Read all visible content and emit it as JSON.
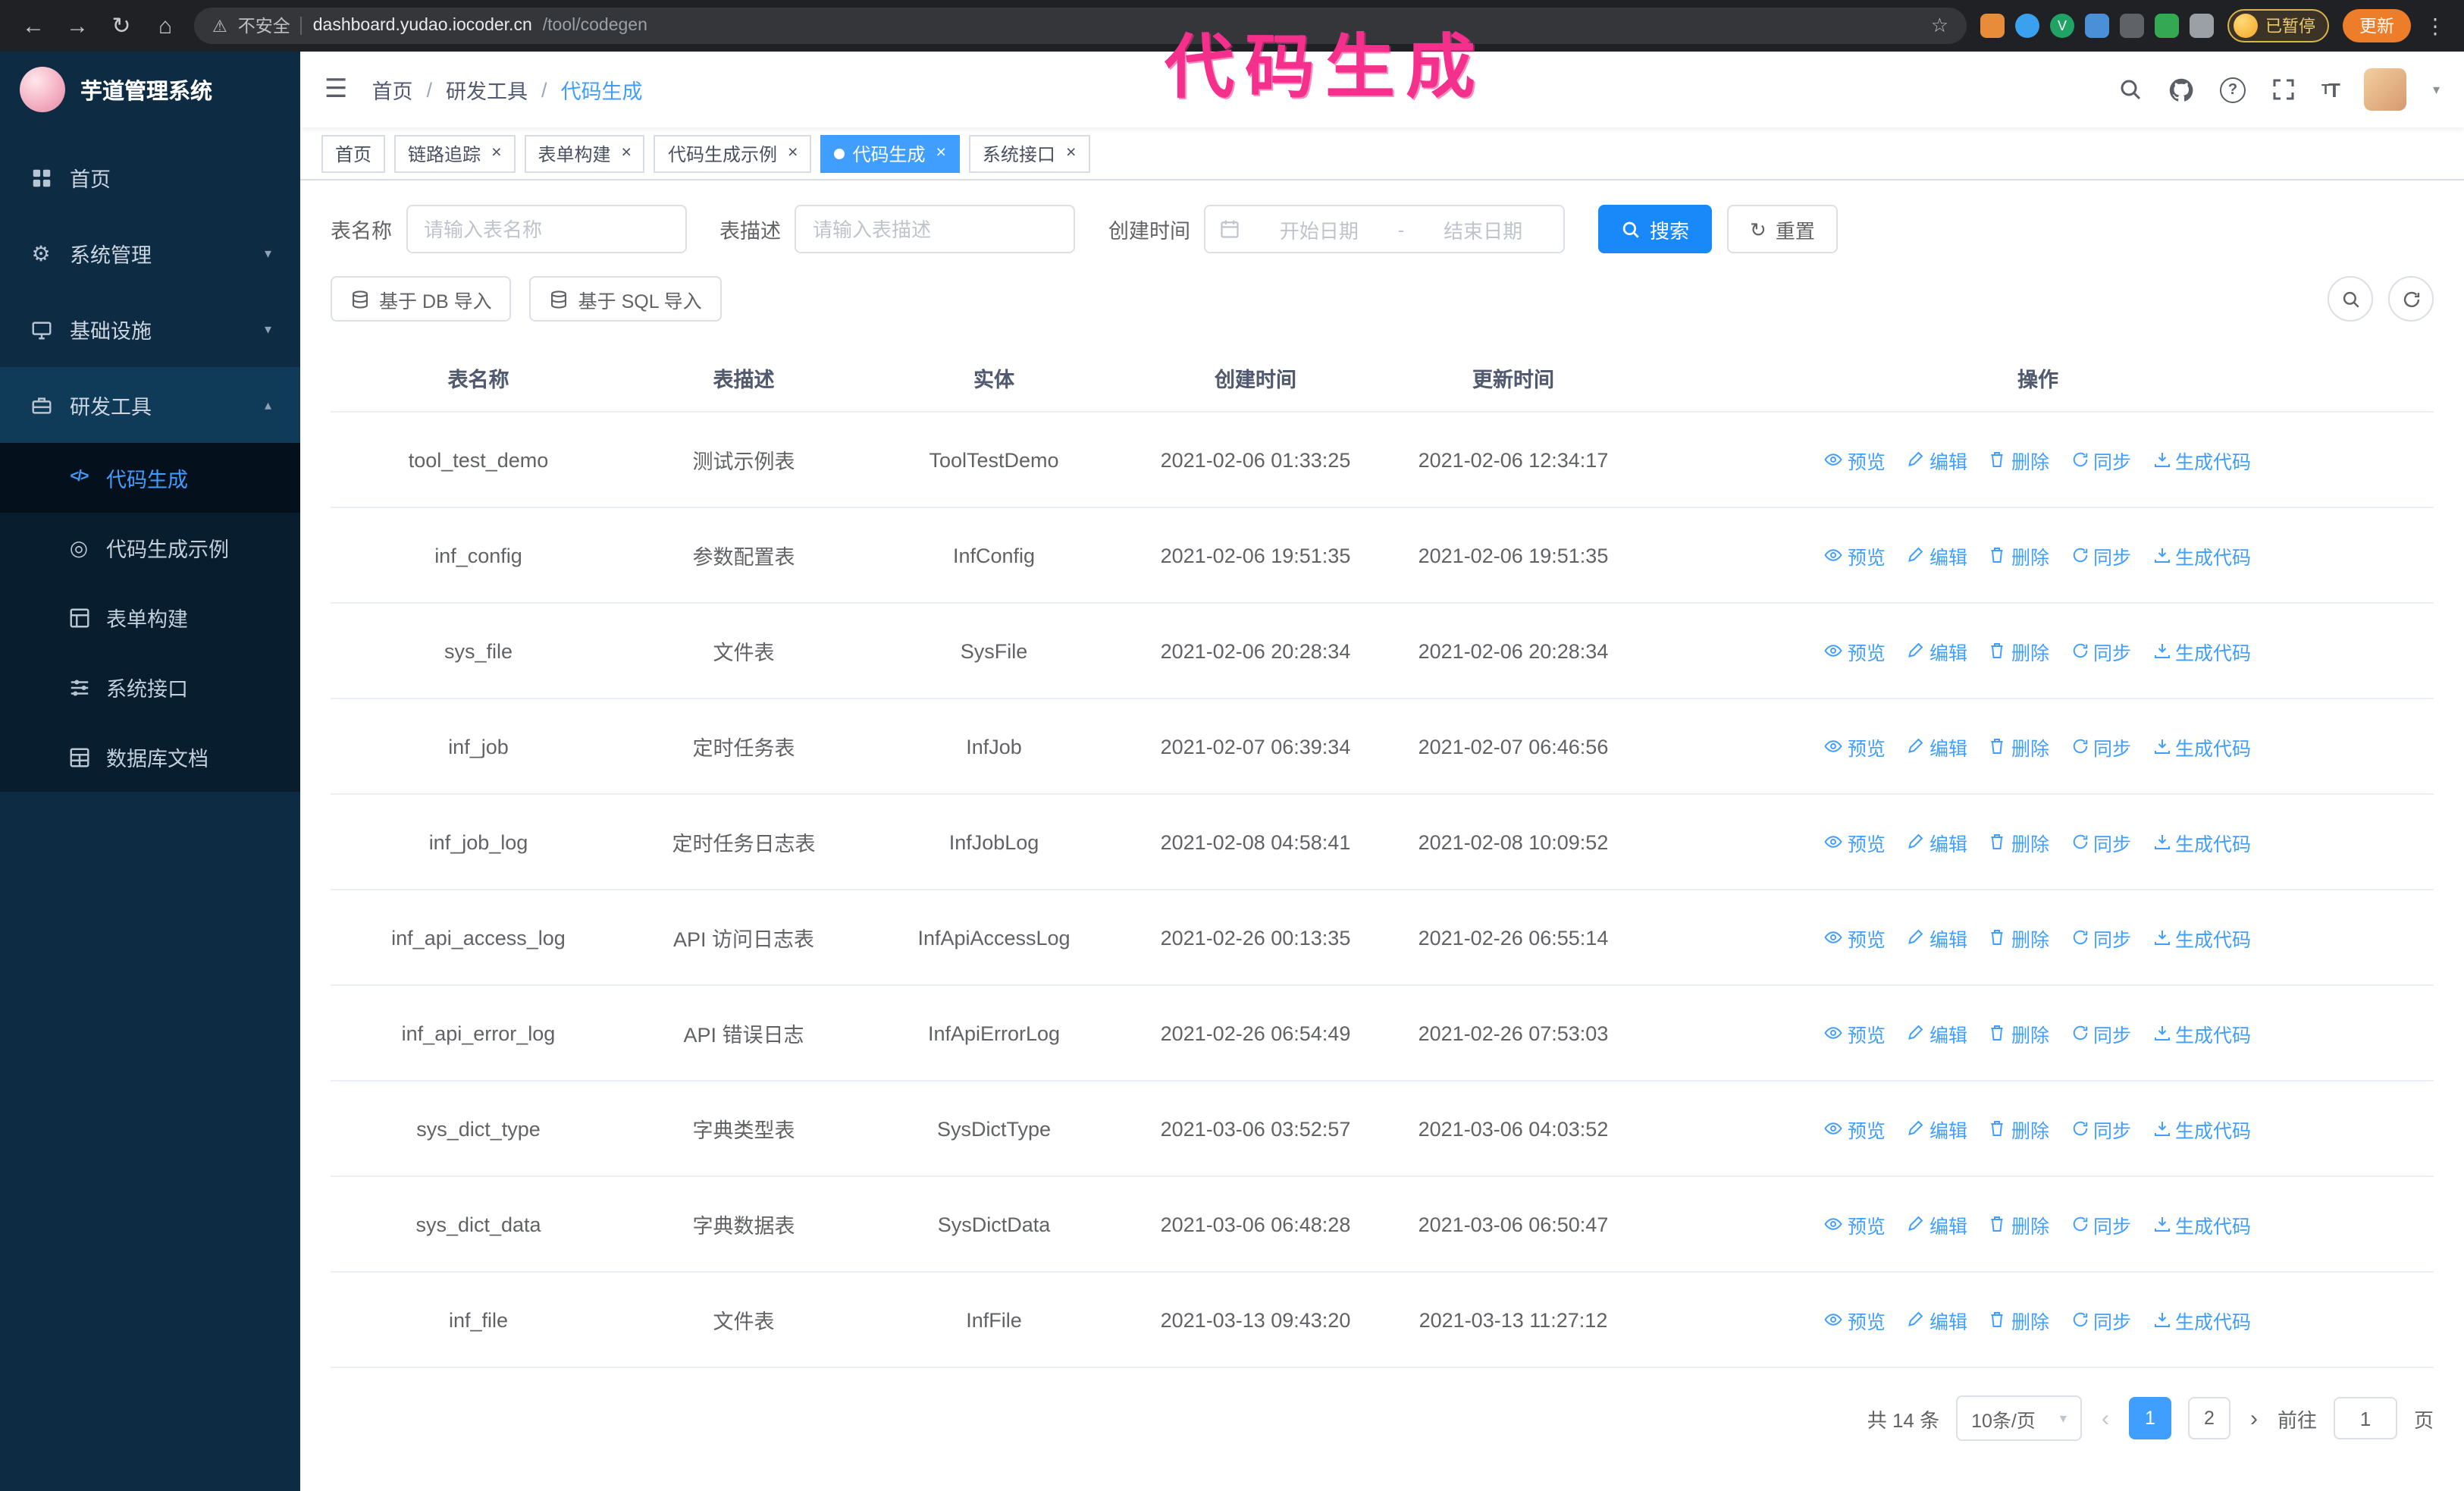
{
  "ui": {
    "close": "×",
    "slash": "/",
    "caret_down": "▾",
    "caret_up": "▴",
    "prev": "‹",
    "next": "›"
  },
  "icons": {
    "back": "←",
    "forward": "→",
    "reload": "↻",
    "home": "⌂",
    "warning": "⚠",
    "star": "☆",
    "more": "⋮",
    "gear": "⚙",
    "target": "◎",
    "hamburger": "☰",
    "code": "</>"
  },
  "browser": {
    "security": "不安全",
    "host": "dashboard.yudao.iocoder.cn",
    "path": "/tool/codegen",
    "paused": "已暂停",
    "update": "更新"
  },
  "annotation": {
    "text": "代码生成"
  },
  "sidebar": {
    "title": "芋道管理系统",
    "items": [
      {
        "label": "首页"
      },
      {
        "label": "系统管理"
      },
      {
        "label": "基础设施"
      },
      {
        "label": "研发工具"
      }
    ],
    "subitems": [
      {
        "label": "代码生成"
      },
      {
        "label": "代码生成示例"
      },
      {
        "label": "表单构建"
      },
      {
        "label": "系统接口"
      },
      {
        "label": "数据库文档"
      }
    ]
  },
  "header": {
    "breadcrumb": [
      "首页",
      "研发工具",
      "代码生成"
    ]
  },
  "tabs": [
    {
      "label": "首页"
    },
    {
      "label": "链路追踪"
    },
    {
      "label": "表单构建"
    },
    {
      "label": "代码生成示例"
    },
    {
      "label": "代码生成"
    },
    {
      "label": "系统接口"
    }
  ],
  "filters": {
    "name_label": "表名称",
    "name_placeholder": "请输入表名称",
    "desc_label": "表描述",
    "desc_placeholder": "请输入表描述",
    "time_label": "创建时间",
    "start_placeholder": "开始日期",
    "range_sep": "-",
    "end_placeholder": "结束日期",
    "search": "搜索",
    "reset": "重置"
  },
  "toolbar": {
    "import_db": "基于 DB 导入",
    "import_sql": "基于 SQL 导入"
  },
  "table": {
    "columns": [
      "表名称",
      "表描述",
      "实体",
      "创建时间",
      "更新时间",
      "操作"
    ],
    "actions": [
      "预览",
      "编辑",
      "删除",
      "同步",
      "生成代码"
    ],
    "rows": [
      {
        "name": "tool_test_demo",
        "desc": "测试示例表",
        "entity": "ToolTestDemo",
        "created": "2021-02-06 01:33:25",
        "updated": "2021-02-06 12:34:17"
      },
      {
        "name": "inf_config",
        "desc": "参数配置表",
        "entity": "InfConfig",
        "created": "2021-02-06 19:51:35",
        "updated": "2021-02-06 19:51:35"
      },
      {
        "name": "sys_file",
        "desc": "文件表",
        "entity": "SysFile",
        "created": "2021-02-06 20:28:34",
        "updated": "2021-02-06 20:28:34"
      },
      {
        "name": "inf_job",
        "desc": "定时任务表",
        "entity": "InfJob",
        "created": "2021-02-07 06:39:34",
        "updated": "2021-02-07 06:46:56"
      },
      {
        "name": "inf_job_log",
        "desc": "定时任务日志表",
        "entity": "InfJobLog",
        "created": "2021-02-08 04:58:41",
        "updated": "2021-02-08 10:09:52"
      },
      {
        "name": "inf_api_access_log",
        "desc": "API 访问日志表",
        "entity": "InfApiAccessLog",
        "created": "2021-02-26 00:13:35",
        "updated": "2021-02-26 06:55:14"
      },
      {
        "name": "inf_api_error_log",
        "desc": "API 错误日志",
        "entity": "InfApiErrorLog",
        "created": "2021-02-26 06:54:49",
        "updated": "2021-02-26 07:53:03"
      },
      {
        "name": "sys_dict_type",
        "desc": "字典类型表",
        "entity": "SysDictType",
        "created": "2021-03-06 03:52:57",
        "updated": "2021-03-06 04:03:52"
      },
      {
        "name": "sys_dict_data",
        "desc": "字典数据表",
        "entity": "SysDictData",
        "created": "2021-03-06 06:48:28",
        "updated": "2021-03-06 06:50:47"
      },
      {
        "name": "inf_file",
        "desc": "文件表",
        "entity": "InfFile",
        "created": "2021-03-13 09:43:20",
        "updated": "2021-03-13 11:27:12"
      }
    ]
  },
  "pagination": {
    "total": "共 14 条",
    "page_size": "10条/页",
    "page1": "1",
    "page2": "2",
    "goto": "前往",
    "goto_value": "1",
    "unit": "页"
  }
}
